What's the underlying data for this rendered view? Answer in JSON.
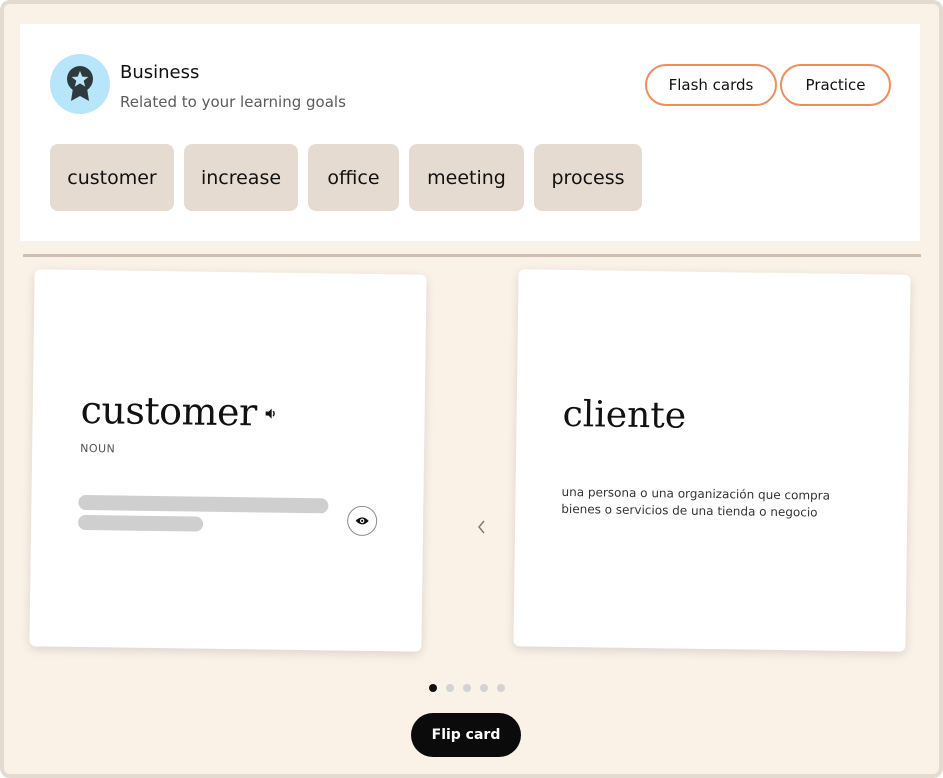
{
  "topic": {
    "title": "Business",
    "subtitle": "Related to your learning goals",
    "badge_icon": "award-star-icon",
    "badge_color": "#b7e6fb"
  },
  "modes": {
    "flash_cards_label": "Flash cards",
    "practice_label": "Practice",
    "accent_color": "#f08d5a"
  },
  "chips": [
    {
      "label": "customer"
    },
    {
      "label": "increase"
    },
    {
      "label": "office"
    },
    {
      "label": "meeting"
    },
    {
      "label": "process"
    }
  ],
  "card_front": {
    "word": "customer",
    "part_of_speech": "NOUN",
    "audio_icon": "speaker-icon",
    "reveal_icon": "eye-icon"
  },
  "card_back": {
    "translation": "cliente",
    "definition": "una persona o una organización que compra bienes o servicios de una tienda o negocio"
  },
  "pagination": {
    "total": 5,
    "active_index": 0
  },
  "flip_button_label": "Flip card"
}
